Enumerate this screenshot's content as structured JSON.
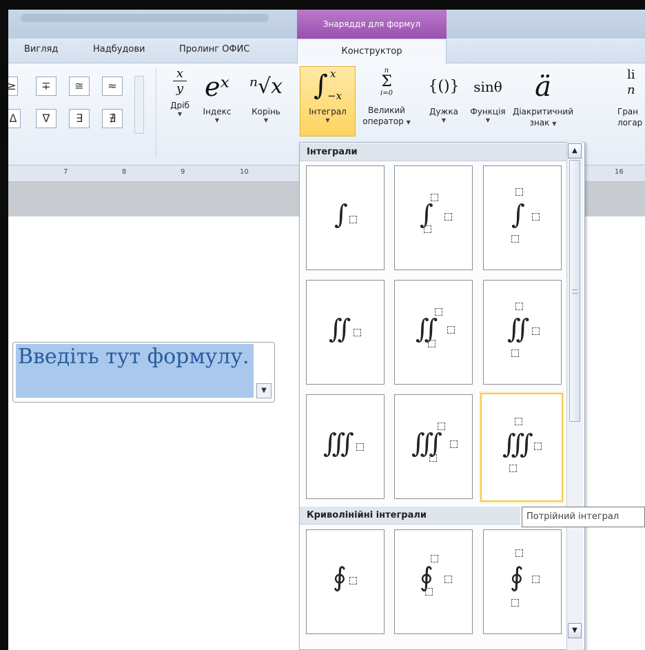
{
  "context_tab": "Знаряддя для формул",
  "tabs": [
    "Вигляд",
    "Надбудови",
    "Пролинг ОФИС"
  ],
  "active_tab": "Конструктор",
  "symbols": [
    "≥",
    "∓",
    "≅",
    "≈",
    "Δ",
    "∇",
    "∃",
    "∄"
  ],
  "ribbon": {
    "fraction": {
      "glyph_top": "x",
      "glyph_bottom": "y",
      "label": "Дріб"
    },
    "script": {
      "glyph": "eˣ",
      "label": "Індекс"
    },
    "radical": {
      "glyph": "ⁿ√x",
      "label": "Корінь"
    },
    "integral": {
      "glyph": "∫",
      "upper": "x",
      "lower": "−x",
      "label": "Інтеграл"
    },
    "large_operator": {
      "glyph_top": "n",
      "glyph": "Σ",
      "glyph_bottom": "i=0",
      "label": "Великий",
      "label2": "оператор"
    },
    "bracket": {
      "glyph": "{()}",
      "label": "Дужка"
    },
    "function": {
      "glyph": "sinθ",
      "label": "Функція"
    },
    "accent": {
      "glyph": "ä",
      "label": "Діакритичний",
      "label2": "знак"
    },
    "limit": {
      "glyph": "li",
      "glyph2": "n",
      "label": "Гран",
      "label2": "логар"
    }
  },
  "ruler_marks": [
    "7",
    "8",
    "9",
    "10",
    "16"
  ],
  "formula_placeholder": "Введіть тут формулу.",
  "gallery": {
    "section1": "Інтеграли",
    "section2": "Криволінійні інтеграли",
    "rows": [
      {
        "sign": "∫"
      },
      {
        "sign": "∬"
      },
      {
        "sign": "∭"
      },
      {
        "sign": "∮"
      }
    ]
  },
  "tooltip": "Потрійний інтеграл"
}
